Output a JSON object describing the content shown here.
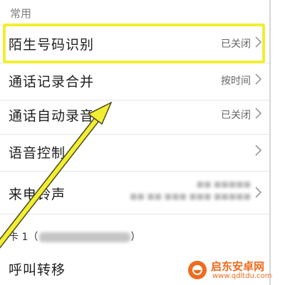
{
  "section": {
    "common_header": "常用"
  },
  "rows": [
    {
      "label": "陌生号码识别",
      "value": "已关闭"
    },
    {
      "label": "通话记录合并",
      "value": "按时间"
    },
    {
      "label": "通话自动录音",
      "value": "已关闭"
    },
    {
      "label": "语音控制",
      "value": ""
    },
    {
      "label": "来电铃声",
      "value": ""
    }
  ],
  "sim": {
    "label": "卡 1（"
  },
  "call_forward": {
    "label": "呼叫转移"
  },
  "watermark": {
    "name": "启东安卓网",
    "url": "www.qdltdu.com"
  },
  "icons": {
    "chevron": "chevron-right-icon",
    "annotation_arrow": "arrow-pointer-icon",
    "watermark_logo": "watermark-logo-icon"
  },
  "colors": {
    "highlight": "#f2ee31",
    "watermark": "#f06b1f"
  }
}
